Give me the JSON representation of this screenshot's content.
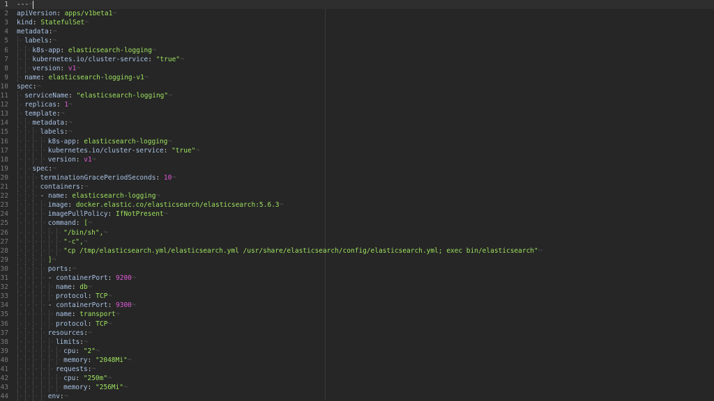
{
  "editor": {
    "current_line": 1,
    "lines": [
      {
        "n": "1",
        "ind": 0,
        "parts": [
          {
            "t": "---",
            "c": "t"
          }
        ],
        "cursor": true
      },
      {
        "n": "2",
        "ind": 0,
        "parts": [
          {
            "t": "apiVersion",
            "c": "k"
          },
          {
            "t": ": ",
            "c": "p"
          },
          {
            "t": "apps/v1beta1",
            "c": "s"
          }
        ]
      },
      {
        "n": "3",
        "ind": 0,
        "parts": [
          {
            "t": "kind",
            "c": "k"
          },
          {
            "t": ": ",
            "c": "p"
          },
          {
            "t": "StatefulSet",
            "c": "s"
          }
        ]
      },
      {
        "n": "4",
        "ind": 0,
        "parts": [
          {
            "t": "metadata",
            "c": "k"
          },
          {
            "t": ":",
            "c": "p"
          }
        ]
      },
      {
        "n": "5",
        "ind": 1,
        "parts": [
          {
            "t": "labels",
            "c": "k"
          },
          {
            "t": ":",
            "c": "p"
          }
        ]
      },
      {
        "n": "6",
        "ind": 2,
        "parts": [
          {
            "t": "k8s-app",
            "c": "k"
          },
          {
            "t": ": ",
            "c": "p"
          },
          {
            "t": "elasticsearch-logging",
            "c": "s"
          }
        ]
      },
      {
        "n": "7",
        "ind": 2,
        "parts": [
          {
            "t": "kubernetes.io/cluster-service",
            "c": "k"
          },
          {
            "t": ": ",
            "c": "p"
          },
          {
            "t": "\"true\"",
            "c": "s"
          }
        ]
      },
      {
        "n": "8",
        "ind": 2,
        "parts": [
          {
            "t": "version",
            "c": "k"
          },
          {
            "t": ": ",
            "c": "p"
          },
          {
            "t": "v1",
            "c": "n"
          }
        ]
      },
      {
        "n": "9",
        "ind": 1,
        "parts": [
          {
            "t": "name",
            "c": "k"
          },
          {
            "t": ": ",
            "c": "p"
          },
          {
            "t": "elasticsearch-logging-v1",
            "c": "s"
          }
        ]
      },
      {
        "n": "10",
        "ind": 0,
        "parts": [
          {
            "t": "spec",
            "c": "k"
          },
          {
            "t": ":",
            "c": "p"
          }
        ]
      },
      {
        "n": "11",
        "ind": 1,
        "parts": [
          {
            "t": "serviceName",
            "c": "k"
          },
          {
            "t": ": ",
            "c": "p"
          },
          {
            "t": "\"elasticsearch-logging\"",
            "c": "s"
          }
        ]
      },
      {
        "n": "12",
        "ind": 1,
        "parts": [
          {
            "t": "replicas",
            "c": "k"
          },
          {
            "t": ": ",
            "c": "p"
          },
          {
            "t": "1",
            "c": "n"
          }
        ]
      },
      {
        "n": "13",
        "ind": 1,
        "parts": [
          {
            "t": "template",
            "c": "k"
          },
          {
            "t": ":",
            "c": "p"
          }
        ]
      },
      {
        "n": "14",
        "ind": 2,
        "parts": [
          {
            "t": "metadata",
            "c": "k"
          },
          {
            "t": ":",
            "c": "p"
          }
        ]
      },
      {
        "n": "15",
        "ind": 3,
        "parts": [
          {
            "t": "labels",
            "c": "k"
          },
          {
            "t": ":",
            "c": "p"
          }
        ]
      },
      {
        "n": "16",
        "ind": 4,
        "parts": [
          {
            "t": "k8s-app",
            "c": "k"
          },
          {
            "t": ": ",
            "c": "p"
          },
          {
            "t": "elasticsearch-logging",
            "c": "s"
          }
        ]
      },
      {
        "n": "17",
        "ind": 4,
        "parts": [
          {
            "t": "kubernetes.io/cluster-service",
            "c": "k"
          },
          {
            "t": ": ",
            "c": "p"
          },
          {
            "t": "\"true\"",
            "c": "s"
          }
        ]
      },
      {
        "n": "18",
        "ind": 4,
        "parts": [
          {
            "t": "version",
            "c": "k"
          },
          {
            "t": ": ",
            "c": "p"
          },
          {
            "t": "v1",
            "c": "n"
          }
        ]
      },
      {
        "n": "19",
        "ind": 2,
        "parts": [
          {
            "t": "spec",
            "c": "k"
          },
          {
            "t": ":",
            "c": "p"
          }
        ]
      },
      {
        "n": "20",
        "ind": 3,
        "parts": [
          {
            "t": "terminationGracePeriodSeconds",
            "c": "k"
          },
          {
            "t": ": ",
            "c": "p"
          },
          {
            "t": "10",
            "c": "n"
          }
        ]
      },
      {
        "n": "21",
        "ind": 3,
        "parts": [
          {
            "t": "containers",
            "c": "k"
          },
          {
            "t": ":",
            "c": "p"
          }
        ]
      },
      {
        "n": "22",
        "ind": 3,
        "parts": [
          {
            "t": "- ",
            "c": "p"
          },
          {
            "t": "name",
            "c": "k"
          },
          {
            "t": ": ",
            "c": "p"
          },
          {
            "t": "elasticsearch-logging",
            "c": "s"
          }
        ]
      },
      {
        "n": "23",
        "ind": 4,
        "parts": [
          {
            "t": "image",
            "c": "k"
          },
          {
            "t": ": ",
            "c": "p"
          },
          {
            "t": "docker.elastic.co/elasticsearch/elasticsearch:5.6.3",
            "c": "s"
          }
        ]
      },
      {
        "n": "24",
        "ind": 4,
        "parts": [
          {
            "t": "imagePullPolicy",
            "c": "k"
          },
          {
            "t": ": ",
            "c": "p"
          },
          {
            "t": "IfNotPresent",
            "c": "s"
          }
        ]
      },
      {
        "n": "25",
        "ind": 4,
        "parts": [
          {
            "t": "command",
            "c": "k"
          },
          {
            "t": ": ",
            "c": "p"
          },
          {
            "t": "[",
            "c": "s"
          }
        ]
      },
      {
        "n": "26",
        "ind": 6,
        "parts": [
          {
            "t": "\"/bin/sh\",",
            "c": "s"
          }
        ]
      },
      {
        "n": "27",
        "ind": 6,
        "parts": [
          {
            "t": "\"-c\",",
            "c": "s"
          }
        ]
      },
      {
        "n": "28",
        "ind": 6,
        "parts": [
          {
            "t": "\"cp /tmp/elasticsearch.yml/elasticsearch.yml /usr/share/elasticsearch/config/elasticsearch.yml; exec bin/elasticsearch\"",
            "c": "s"
          }
        ]
      },
      {
        "n": "29",
        "ind": 4,
        "parts": [
          {
            "t": "]",
            "c": "s"
          }
        ]
      },
      {
        "n": "30",
        "ind": 4,
        "parts": [
          {
            "t": "ports",
            "c": "k"
          },
          {
            "t": ":",
            "c": "p"
          }
        ]
      },
      {
        "n": "31",
        "ind": 4,
        "parts": [
          {
            "t": "- ",
            "c": "p"
          },
          {
            "t": "containerPort",
            "c": "k"
          },
          {
            "t": ": ",
            "c": "p"
          },
          {
            "t": "9200",
            "c": "n"
          }
        ]
      },
      {
        "n": "32",
        "ind": 5,
        "parts": [
          {
            "t": "name",
            "c": "k"
          },
          {
            "t": ": ",
            "c": "p"
          },
          {
            "t": "db",
            "c": "s"
          }
        ]
      },
      {
        "n": "33",
        "ind": 5,
        "parts": [
          {
            "t": "protocol",
            "c": "k"
          },
          {
            "t": ": ",
            "c": "p"
          },
          {
            "t": "TCP",
            "c": "s"
          }
        ]
      },
      {
        "n": "34",
        "ind": 4,
        "parts": [
          {
            "t": "- ",
            "c": "p"
          },
          {
            "t": "containerPort",
            "c": "k"
          },
          {
            "t": ": ",
            "c": "p"
          },
          {
            "t": "9300",
            "c": "n"
          }
        ]
      },
      {
        "n": "35",
        "ind": 5,
        "parts": [
          {
            "t": "name",
            "c": "k"
          },
          {
            "t": ": ",
            "c": "p"
          },
          {
            "t": "transport",
            "c": "s"
          }
        ]
      },
      {
        "n": "36",
        "ind": 5,
        "parts": [
          {
            "t": "protocol",
            "c": "k"
          },
          {
            "t": ": ",
            "c": "p"
          },
          {
            "t": "TCP",
            "c": "s"
          }
        ]
      },
      {
        "n": "37",
        "ind": 4,
        "parts": [
          {
            "t": "resources",
            "c": "k"
          },
          {
            "t": ":",
            "c": "p"
          }
        ]
      },
      {
        "n": "38",
        "ind": 5,
        "parts": [
          {
            "t": "limits",
            "c": "k"
          },
          {
            "t": ":",
            "c": "p"
          }
        ]
      },
      {
        "n": "39",
        "ind": 6,
        "parts": [
          {
            "t": "cpu",
            "c": "k"
          },
          {
            "t": ": ",
            "c": "p"
          },
          {
            "t": "\"2\"",
            "c": "s"
          }
        ]
      },
      {
        "n": "40",
        "ind": 6,
        "parts": [
          {
            "t": "memory",
            "c": "k"
          },
          {
            "t": ": ",
            "c": "p"
          },
          {
            "t": "\"2048Mi\"",
            "c": "s"
          }
        ]
      },
      {
        "n": "41",
        "ind": 5,
        "parts": [
          {
            "t": "requests",
            "c": "k"
          },
          {
            "t": ":",
            "c": "p"
          }
        ]
      },
      {
        "n": "42",
        "ind": 6,
        "parts": [
          {
            "t": "cpu",
            "c": "k"
          },
          {
            "t": ": ",
            "c": "p"
          },
          {
            "t": "\"250m\"",
            "c": "s"
          }
        ]
      },
      {
        "n": "43",
        "ind": 6,
        "parts": [
          {
            "t": "memory",
            "c": "k"
          },
          {
            "t": ": ",
            "c": "p"
          },
          {
            "t": "\"256Mi\"",
            "c": "s"
          }
        ]
      },
      {
        "n": "44",
        "ind": 4,
        "parts": [
          {
            "t": "env",
            "c": "k"
          },
          {
            "t": ":",
            "c": "p"
          }
        ]
      }
    ]
  },
  "colors": {
    "background": "#262626",
    "key": "#a9c3e6",
    "string": "#9fe35f",
    "number": "#e05ad8",
    "line_number": "#7a7a7a"
  }
}
